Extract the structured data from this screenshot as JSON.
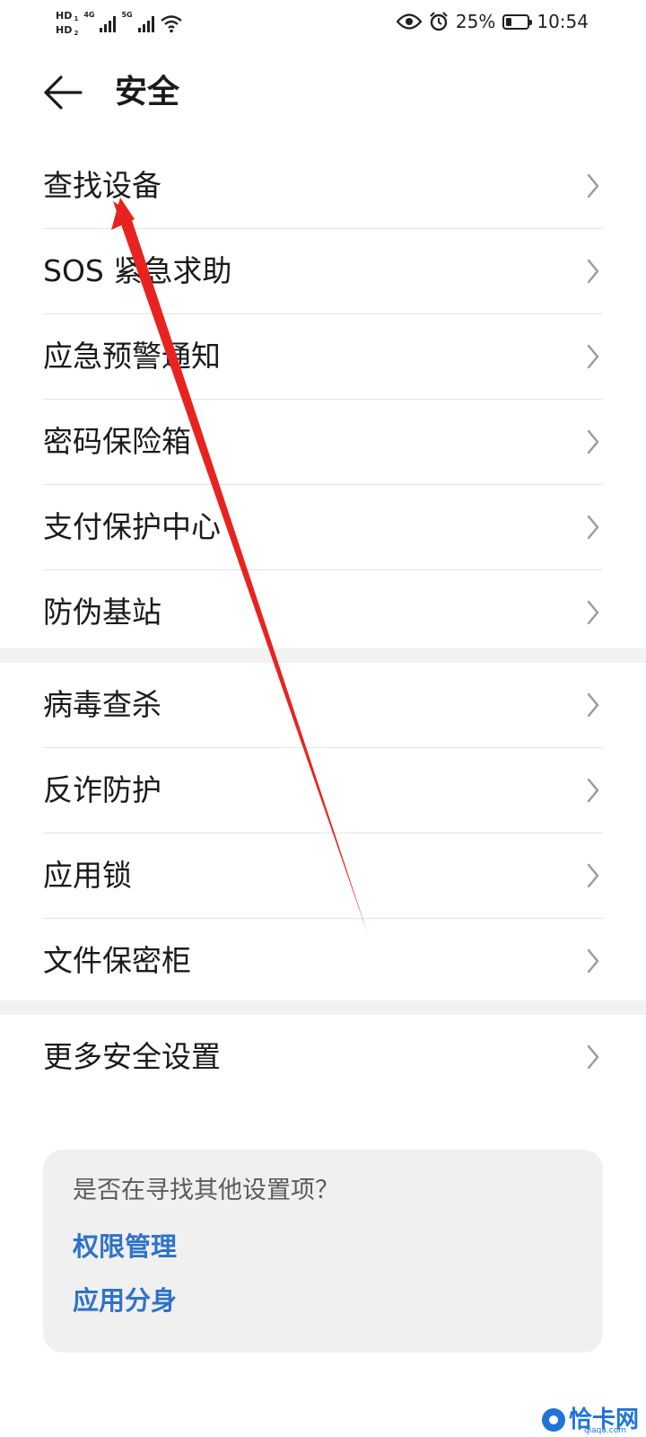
{
  "status_bar": {
    "sim1": "HD",
    "sim1_sub": "1",
    "sim2": "HD",
    "sim2_sub": "2",
    "net1": "4G",
    "net2": "5G",
    "battery_percent": "25%",
    "battery_level": 0.25,
    "time": "10:54",
    "icons": [
      "signal-icon",
      "signal-icon",
      "wifi-icon",
      "eye-icon",
      "alarm-icon",
      "battery-icon"
    ]
  },
  "header": {
    "back_icon": "arrow-left-icon",
    "title": "安全"
  },
  "groups": [
    {
      "items": [
        {
          "label": "查找设备"
        },
        {
          "label": "SOS 紧急求助"
        },
        {
          "label": "应急预警通知"
        },
        {
          "label": "密码保险箱"
        },
        {
          "label": "支付保护中心"
        },
        {
          "label": "防伪基站"
        }
      ]
    },
    {
      "items": [
        {
          "label": "病毒查杀"
        },
        {
          "label": "反诈防护"
        },
        {
          "label": "应用锁"
        },
        {
          "label": "文件保密柜"
        }
      ]
    },
    {
      "items": [
        {
          "label": "更多安全设置"
        }
      ]
    }
  ],
  "suggestion_card": {
    "hint": "是否在寻找其他设置项？",
    "links": [
      "权限管理",
      "应用分身"
    ]
  },
  "watermark": {
    "text": "恰卡网",
    "sub": "qiaqa.com"
  },
  "colors": {
    "background": "#ffffff",
    "section_gap": "#f2f2f2",
    "card_background": "#f0f0f0",
    "link": "#2f73c8",
    "annotation_arrow": "#e8231f",
    "watermark": "#1f73d9"
  }
}
